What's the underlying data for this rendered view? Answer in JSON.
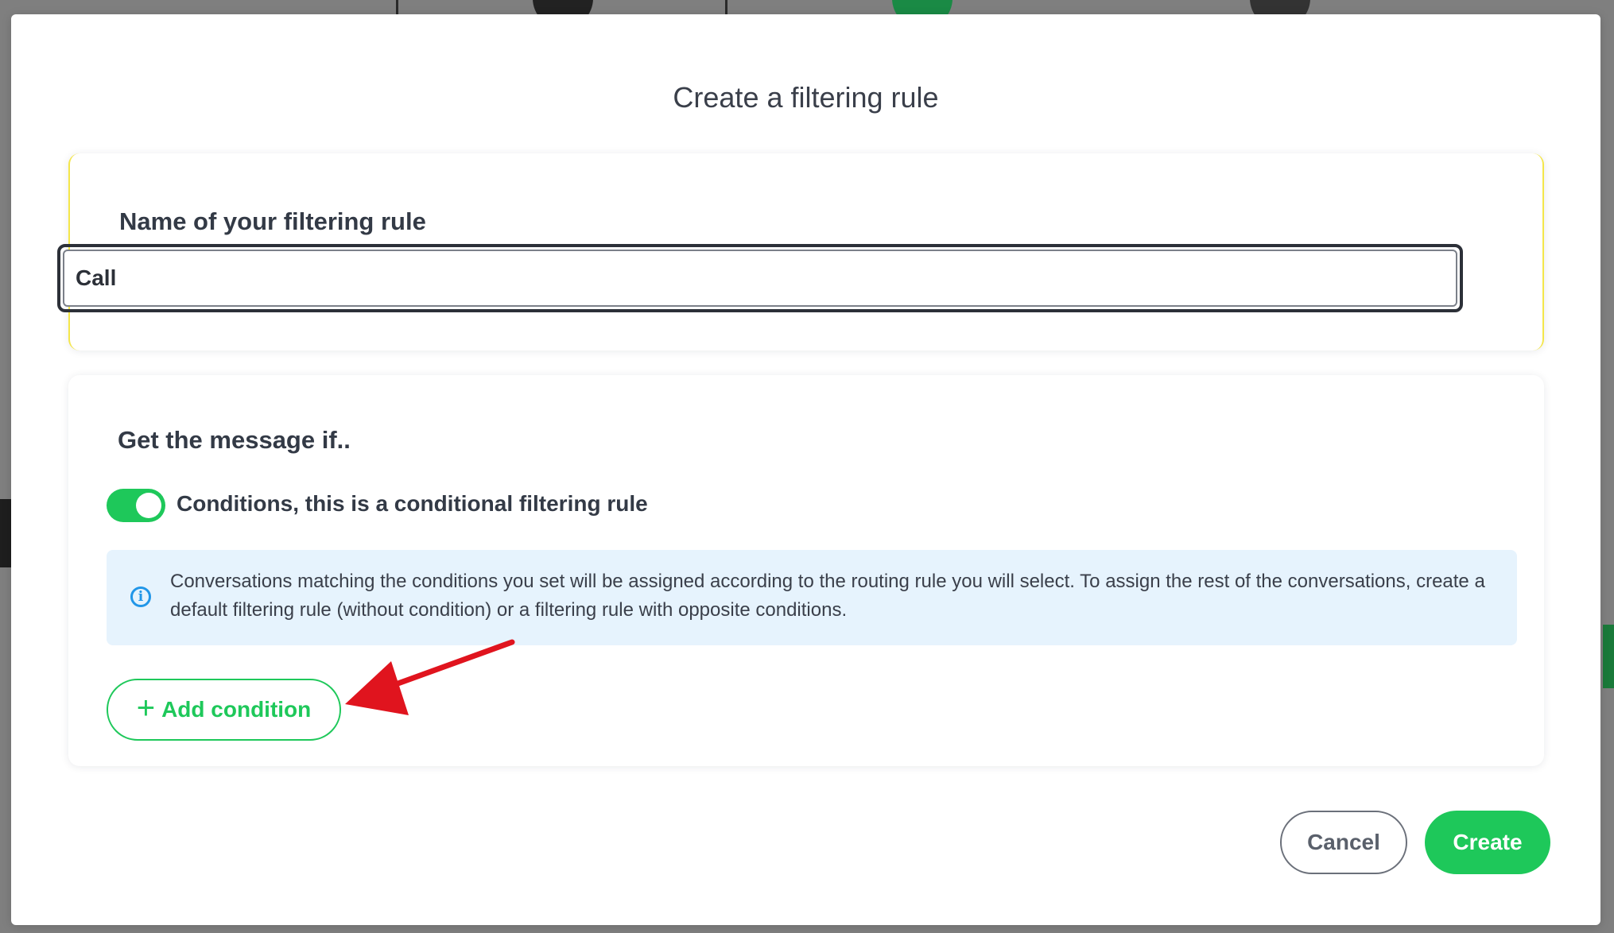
{
  "modal": {
    "title": "Create a filtering rule"
  },
  "name_section": {
    "label": "Name of your filtering rule",
    "input_value": "Call"
  },
  "conditions_section": {
    "label": "Get the message if..",
    "toggle_label": "Conditions, this is a conditional filtering rule",
    "toggle_on": true,
    "info_text": "Conversations matching the conditions you set will be assigned according to the routing rule you will select. To assign the rest of the conversations, create a default filtering rule (without condition) or a filtering rule with opposite conditions.",
    "add_button_label": "Add condition"
  },
  "footer": {
    "cancel_label": "Cancel",
    "create_label": "Create"
  },
  "colors": {
    "accent_green": "#1ec85a",
    "info_blue": "#2196e8",
    "info_bg": "#e6f3fd",
    "annotation_red": "#e0141e"
  },
  "icons": {
    "info": "info-icon",
    "plus": "plus-icon",
    "annotation": "red-arrow-annotation"
  }
}
